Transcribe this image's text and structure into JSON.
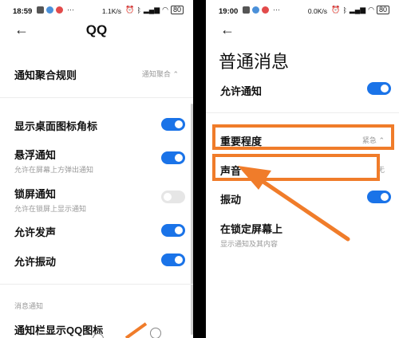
{
  "left": {
    "status": {
      "time": "18:59",
      "speed": "1.1K/s",
      "battery": "80"
    },
    "title": "QQ",
    "rows": {
      "aggregate": {
        "label": "通知聚合规则",
        "value": "通知聚合"
      },
      "badge": {
        "label": "显示桌面图标角标"
      },
      "float": {
        "label": "悬浮通知",
        "sub": "允许在屏幕上方弹出通知"
      },
      "lock": {
        "label": "锁屏通知",
        "sub": "允许在锁屏上显示通知"
      },
      "sound": {
        "label": "允许发声"
      },
      "vibrate": {
        "label": "允许振动"
      }
    },
    "section_header": "消息通知",
    "statusbar_icon": {
      "label": "通知栏显示QQ图标"
    }
  },
  "right": {
    "status": {
      "time": "19:00",
      "speed": "0.0K/s",
      "battery": "80"
    },
    "title": "普通消息",
    "rows": {
      "allow": {
        "label": "允许通知"
      },
      "importance": {
        "label": "重要程度",
        "value": "紧急"
      },
      "sound": {
        "label": "声音",
        "value": "无"
      },
      "vibrate": {
        "label": "振动"
      },
      "lockscreen": {
        "label": "在锁定屏幕上",
        "sub": "显示通知及其内容"
      }
    }
  },
  "colors": {
    "toggle_on": "#1a73e8",
    "highlight": "#f07c2a"
  },
  "icons": [
    "back-arrow-icon",
    "chevron-updown-icon",
    "wifi-icon",
    "battery-icon"
  ]
}
